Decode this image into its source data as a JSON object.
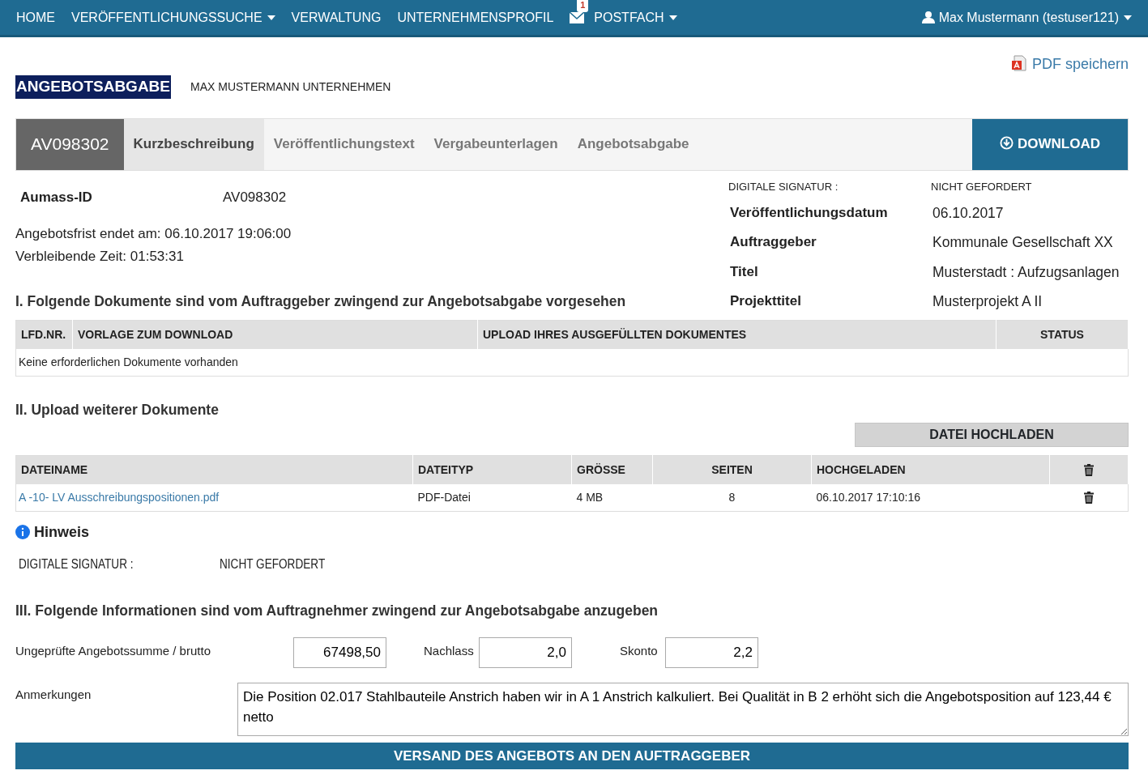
{
  "navbar": {
    "items": [
      {
        "kind": "link",
        "label": "HOME"
      },
      {
        "kind": "dropdown",
        "label": "VERÖFFENTLICHUNGSSUCHE"
      },
      {
        "kind": "link",
        "label": "VERWALTUNG"
      },
      {
        "kind": "link",
        "label": "UNTERNEHMENSPROFIL"
      },
      {
        "kind": "mail",
        "badge": "1"
      },
      {
        "kind": "dropdown",
        "label": "POSTFACH"
      }
    ],
    "user": "Max Mustermann (testuser121)"
  },
  "pdf_link": "PDF speichern",
  "page_title": "ANGEBOTSABGABE",
  "company": "MAX MUSTERMANN UNTERNEHMEN",
  "record_id": "AV098302",
  "tabs": [
    {
      "label": "Kurzbeschreibung",
      "selected": true
    },
    {
      "label": "Veröffentlichungstext",
      "selected": false
    },
    {
      "label": "Vergabeunterlagen",
      "selected": false
    },
    {
      "label": "Angebotsabgabe",
      "selected": false
    }
  ],
  "download_button": "DOWNLOAD",
  "aumass": {
    "label": "Aumass-ID",
    "value": "AV098302"
  },
  "deadline": "Angebotsfrist endet am: 06.10.2017 19:06:00",
  "remaining": "Verbleibende Zeit: 01:53:31",
  "signature_top": {
    "label": "DIGITALE SIGNATUR :",
    "value": "NICHT GEFORDERT"
  },
  "details": [
    {
      "label": "Veröffentlichungsdatum",
      "value": "06.10.2017"
    },
    {
      "label": "Auftraggeber",
      "value": "Kommunale Gesellschaft XX"
    },
    {
      "label": "Titel",
      "value": "Musterstadt : Aufzugsanlagen"
    },
    {
      "label": "Projekttitel",
      "value": "Musterprojekt A II"
    }
  ],
  "section1": {
    "heading": "I. Folgende Dokumente sind vom Auftraggeber zwingend zur Angebotsabgabe vorgesehen",
    "columns": [
      "LFD.NR.",
      "VORLAGE ZUM DOWNLOAD",
      "UPLOAD IHRES AUSGEFÜLLTEN DOKUMENTES",
      "STATUS"
    ],
    "empty_text": "Keine erforderlichen Dokumente vorhanden"
  },
  "section2": {
    "heading": "II. Upload weiterer Dokumente",
    "upload_button": "DATEI HOCHLADEN",
    "columns": [
      "DATEINAME",
      "DATEITYP",
      "GRÖSSE",
      "SEITEN",
      "HOCHGELADEN"
    ],
    "rows": [
      {
        "name": "A -10- LV Ausschreibungspositionen.pdf",
        "type": "PDF-Datei",
        "size": "4 MB",
        "pages": "8",
        "uploaded": "06.10.2017 17:10:16"
      }
    ]
  },
  "hint": {
    "title": "Hinweis",
    "label": "DIGITALE SIGNATUR :",
    "value": "NICHT GEFORDERT"
  },
  "section3": {
    "heading": "III. Folgende Informationen sind vom Auftragnehmer zwingend zur Angebotsabgabe anzugeben",
    "sum_label": "Ungeprüfte Angebotssumme / brutto",
    "sum_value": "67498,50",
    "discount_label": "Nachlass",
    "discount_value": "2,0",
    "skonto_label": "Skonto",
    "skonto_value": "2,2",
    "notes_label": "Anmerkungen",
    "notes_value": "Die Position 02.017 Stahlbauteile Anstrich haben wir in A 1 Anstrich kalkuliert. Bei Qualität in B 2 erhöht sich die Angebotsposition auf 123,44 € netto"
  },
  "submit_button": "VERSAND DES ANGEBOTS AN DEN AUFTRAGGEBER"
}
